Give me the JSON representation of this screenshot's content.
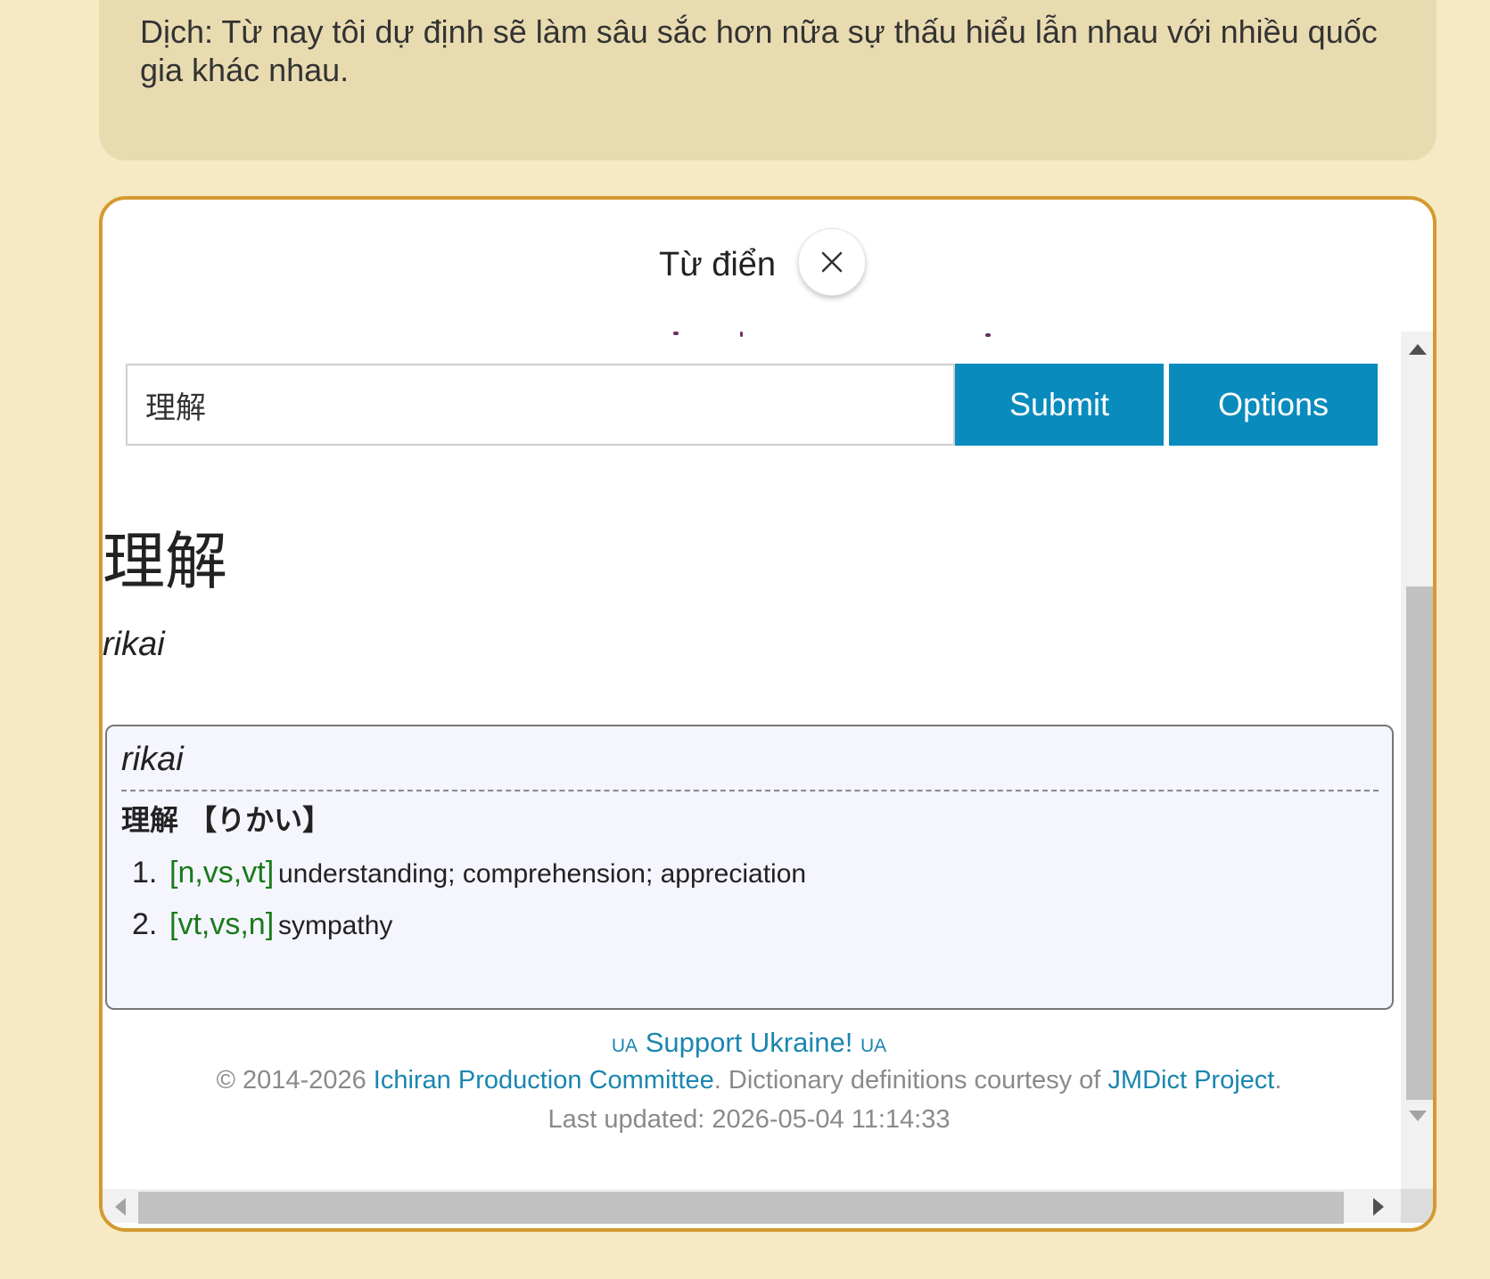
{
  "translation": {
    "text": "Dịch: Từ nay tôi dự định sẽ làm sâu sắc hơn nữa sự thấu hiểu lẫn nhau với nhiều quốc gia khác nhau."
  },
  "modal": {
    "title": "Từ điển",
    "close_icon": "close-x-icon"
  },
  "search": {
    "value": "理解",
    "submit_label": "Submit",
    "options_label": "Options"
  },
  "result": {
    "headword": "理解",
    "romaji": "rikai",
    "entry": {
      "romaji": "rikai",
      "reading": "理解 【りかい】",
      "senses": [
        {
          "num": "1.",
          "pos": "[n,vs,vt]",
          "gloss": "understanding; comprehension; appreciation"
        },
        {
          "num": "2.",
          "pos": "[vt,vs,n]",
          "gloss": "sympathy"
        }
      ]
    }
  },
  "footer": {
    "ua_left": "UA",
    "support": "Support Ukraine!",
    "ua_right": "UA",
    "copyright_prefix": "© 2014-2026",
    "committee_link": "Ichiran Production Committee",
    "courtesy": ". Dictionary definitions courtesy of",
    "jmdict_link": "JMDict Project",
    "period": ".",
    "last_updated": "Last updated: 2026-05-04 11:14:33"
  },
  "colors": {
    "page_bg": "#f6e9c3",
    "card_bg": "#e9dbb0",
    "modal_border": "#d49a30",
    "button_bg": "#0a8bbd",
    "pos_green": "#1a7a1a",
    "link_blue": "#1a86b0",
    "entry_bg": "#f4f5fd"
  }
}
